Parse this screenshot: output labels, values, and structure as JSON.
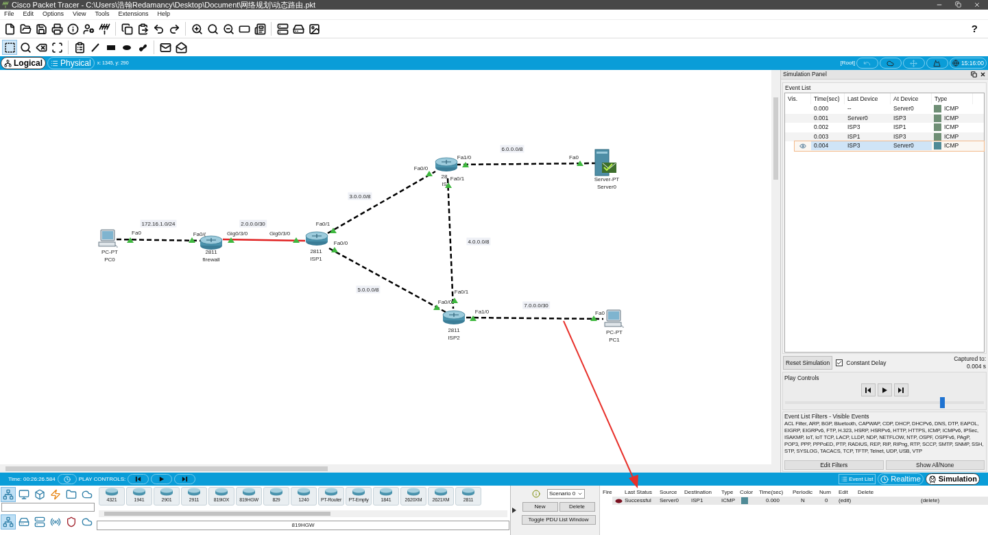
{
  "window": {
    "title": "Cisco Packet Tracer - C:\\Users\\浩翰Redamancy\\Desktop\\Document\\网络规划\\动态路由.pkt"
  },
  "menu": [
    "File",
    "Edit",
    "Options",
    "View",
    "Tools",
    "Extensions",
    "Help"
  ],
  "help_button": "?",
  "view_tabs": [
    {
      "label": "Logical",
      "selected": true
    },
    {
      "label": "Physical",
      "selected": false
    }
  ],
  "cursor_position": "x: 1345, y: 290",
  "workspace_path": "[Root]",
  "clock": "15:16:00",
  "topology": {
    "devices": [
      {
        "kind": "pc",
        "model": "PC-PT",
        "name": "PC0"
      },
      {
        "kind": "router",
        "model": "2811",
        "name": "firewall"
      },
      {
        "kind": "router",
        "model": "2811",
        "name": "ISP1"
      },
      {
        "kind": "router",
        "model": "28",
        "name": "IS"
      },
      {
        "kind": "server",
        "model": "Server-PT",
        "name": "Server0"
      },
      {
        "kind": "router",
        "model": "2811",
        "name": "ISP2"
      },
      {
        "kind": "pc",
        "model": "PC-PT",
        "name": "PC1"
      }
    ],
    "links": [
      {
        "network": "172.16.1.0/24",
        "ports": [
          "Fa0",
          "Fa0/("
        ],
        "kind": "crossover",
        "color": "#000000"
      },
      {
        "network": "2.0.0.0/30",
        "ports": [
          "Gig0/3/0",
          "Gig0/3/0"
        ],
        "kind": "serial",
        "color": "#e02020"
      },
      {
        "network": "3.0.0.0/8",
        "ports": [
          "Fa0/1",
          "Fa0/0"
        ],
        "kind": "crossover",
        "color": "#000000"
      },
      {
        "network": "5.0.0.0/8",
        "ports": [
          "Fa0/0",
          "Fa0/0"
        ],
        "kind": "crossover",
        "color": "#000000"
      },
      {
        "network": "6.0.0.0/8",
        "ports": [
          "Fa1/0",
          "Fa0"
        ],
        "kind": "crossover",
        "color": "#000000"
      },
      {
        "network": "4.0.0.0/8",
        "ports": [
          "Fa0/1",
          "Fa0/1"
        ],
        "kind": "crossover",
        "color": "#000000"
      },
      {
        "network": "7.0.0.0/30",
        "ports": [
          "Fa1/0",
          "Fa0"
        ],
        "kind": "crossover",
        "color": "#000000"
      }
    ]
  },
  "simulation_panel": {
    "title": "Simulation Panel",
    "event_list": {
      "label": "Event List",
      "columns": [
        "Vis.",
        "Time(sec)",
        "Last Device",
        "At Device",
        "Type"
      ],
      "rows": [
        {
          "visible": false,
          "time": "0.000",
          "last_device": "--",
          "at_device": "Server0",
          "color": "#6f8f76",
          "type": "ICMP",
          "selected": false
        },
        {
          "visible": false,
          "time": "0.001",
          "last_device": "Server0",
          "at_device": "ISP3",
          "color": "#6f8f76",
          "type": "ICMP",
          "selected": false
        },
        {
          "visible": false,
          "time": "0.002",
          "last_device": "ISP3",
          "at_device": "ISP1",
          "color": "#6f8f76",
          "type": "ICMP",
          "selected": false
        },
        {
          "visible": false,
          "time": "0.003",
          "last_device": "ISP1",
          "at_device": "ISP3",
          "color": "#6f8f76",
          "type": "ICMP",
          "selected": false
        },
        {
          "visible": true,
          "time": "0.004",
          "last_device": "ISP3",
          "at_device": "Server0",
          "color": "#4f8a96",
          "type": "ICMP",
          "selected": true
        }
      ]
    },
    "reset_button": "Reset Simulation",
    "constant_delay": {
      "label": "Constant Delay",
      "checked": true
    },
    "captured_label": "Captured to:",
    "captured_value": "0.004 s",
    "play_controls": {
      "label": "Play Controls",
      "level": 0.79
    },
    "filters": {
      "title": "Event List Filters - Visible Events",
      "text": "ACL Filter, ARP, BGP, Bluetooth, CAPWAP, CDP, DHCP, DHCPv6, DNS, DTP, EAPOL, EIGRP, EIGRPv6, FTP, H.323, HSRP, HSRPv6, HTTP, HTTPS, ICMP, ICMPv6, IPSec, ISAKMP, IoT, IoT TCP, LACP, LLDP, NDP, NETFLOW, NTP, OSPF, OSPFv6, PAgP, POP3, PPP, PPPoED, PTP, RADIUS, REP, RIP, RIPng, RTP, SCCP, SMTP, SNMP, SSH, STP, SYSLOG, TACACS, TCP, TFTP, Telnet, UDP, USB, VTP",
      "buttons": [
        "Edit Filters",
        "Show All/None"
      ]
    }
  },
  "status_bar": {
    "time": "Time: 00:26:26.584",
    "play_controls_label": "PLAY CONTROLS:",
    "event_list_button": "Event List",
    "modes": [
      {
        "label": "Realtime",
        "selected": false
      },
      {
        "label": "Simulation",
        "selected": true
      }
    ]
  },
  "device_palette": {
    "categories": [
      {
        "kind": "network",
        "selected": true
      },
      {
        "kind": "end",
        "selected": false
      },
      {
        "kind": "components",
        "selected": false
      },
      {
        "kind": "connections",
        "selected": false
      },
      {
        "kind": "misc",
        "selected": false
      },
      {
        "kind": "cloud",
        "selected": false
      }
    ],
    "subcategories": [
      {
        "kind": "routers",
        "selected": true
      },
      {
        "kind": "switches",
        "selected": false
      },
      {
        "kind": "hubs",
        "selected": false
      },
      {
        "kind": "wireless",
        "selected": false
      },
      {
        "kind": "security",
        "selected": false
      },
      {
        "kind": "wan",
        "selected": false
      }
    ],
    "models": [
      "4321",
      "1941",
      "2901",
      "2911",
      "819IOX",
      "819HGW",
      "829",
      "1240",
      "PT-Router",
      "PT-Empty",
      "1841",
      "2620XM",
      "2621XM",
      "2811"
    ],
    "selected_model": "819HGW"
  },
  "scenario": {
    "value": "Scenario 0",
    "buttons": [
      "New",
      "Delete"
    ],
    "toggle_button": "Toggle PDU List Window"
  },
  "pdu_table": {
    "columns": [
      "Fire",
      "Last Status",
      "Source",
      "Destination",
      "Type",
      "Color",
      "Time(sec)",
      "Periodic",
      "Num",
      "Edit",
      "Delete"
    ],
    "rows": [
      {
        "last_status": "Successful",
        "source": "Server0",
        "destination": "ISP1",
        "type": "ICMP",
        "color": "#4f8a96",
        "time": "0.000",
        "periodic": "N",
        "num": "0",
        "edit": "(edit)",
        "delete": "(delete)"
      }
    ]
  }
}
